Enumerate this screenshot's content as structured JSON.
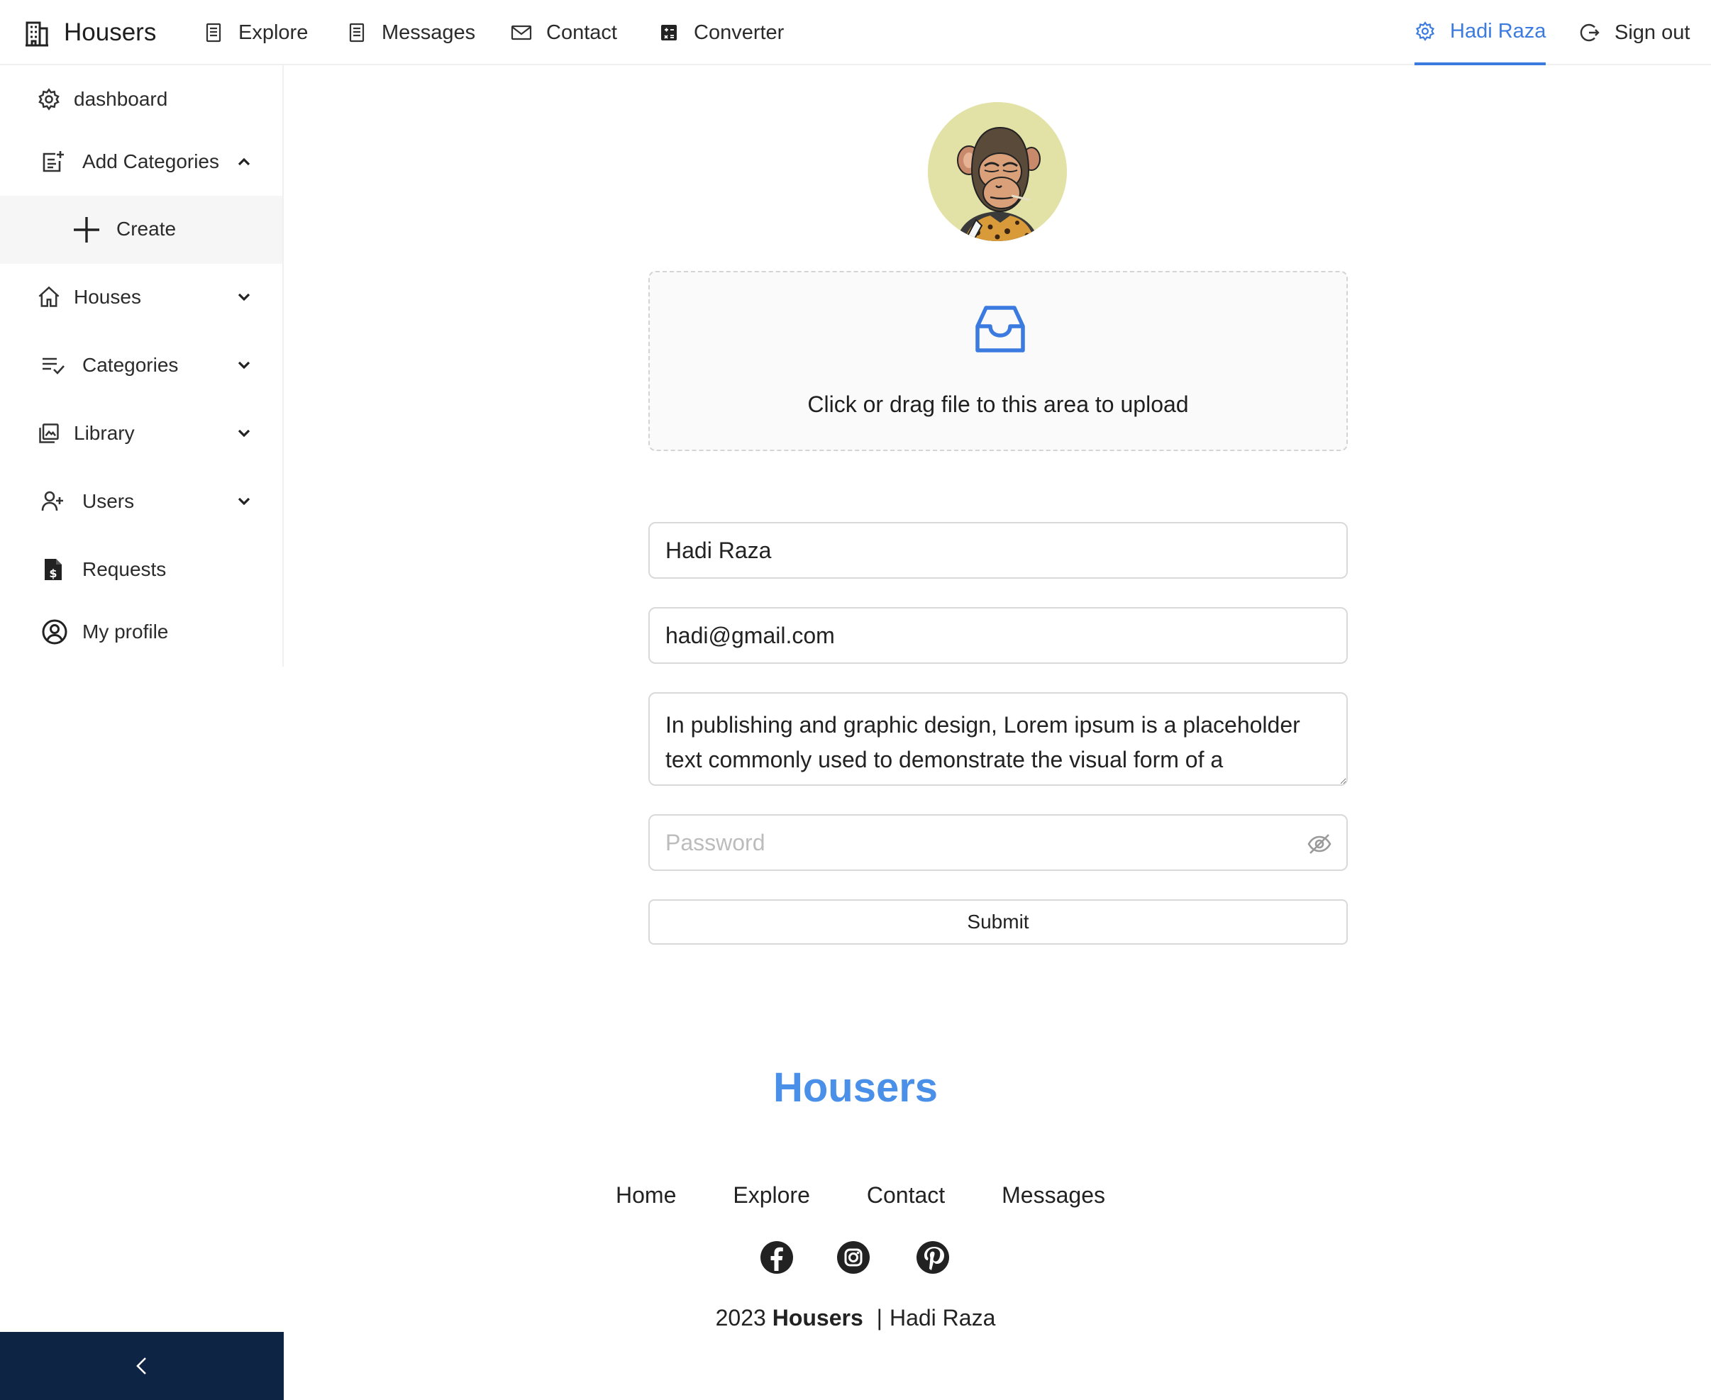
{
  "header": {
    "brand": "Housers",
    "nav": [
      {
        "label": "Explore",
        "icon": "building-icon"
      },
      {
        "label": "Messages",
        "icon": "building-icon"
      },
      {
        "label": "Contact",
        "icon": "mail-icon"
      },
      {
        "label": "Converter",
        "icon": "calculator-icon"
      }
    ],
    "user_label": "Hadi Raza",
    "signout_label": "Sign out",
    "accent_color": "#3b7be0"
  },
  "sidebar": {
    "items": [
      {
        "label": "dashboard",
        "icon": "gear-icon"
      },
      {
        "label": "Add Categories",
        "icon": "add-note-icon",
        "expanded": true
      },
      {
        "label": "Create",
        "icon": "plus-icon"
      },
      {
        "label": "Houses",
        "icon": "home-icon"
      },
      {
        "label": "Categories",
        "icon": "checklist-icon"
      },
      {
        "label": "Library",
        "icon": "library-icon"
      },
      {
        "label": "Users",
        "icon": "user-add-icon"
      },
      {
        "label": "Requests",
        "icon": "invoice-icon"
      },
      {
        "label": "My profile",
        "icon": "user-circle-icon"
      }
    ],
    "collapse_color": "#0d2444"
  },
  "form": {
    "upload_text": "Click or drag file to this area to upload",
    "name_value": "Hadi Raza",
    "email_value": "hadi@gmail.com",
    "bio_value": "In publishing and graphic design, Lorem ipsum is a placeholder text commonly used to demonstrate the visual form of a",
    "password_placeholder": "Password",
    "submit_label": "Submit"
  },
  "footer": {
    "brand": "Housers",
    "brand_color": "#4a90e8",
    "links": [
      "Home",
      "Explore",
      "Contact",
      "Messages"
    ],
    "social": [
      "facebook-icon",
      "instagram-icon",
      "pinterest-icon"
    ],
    "year": "2023",
    "company": "Housers",
    "separator": "|",
    "author": "Hadi Raza"
  }
}
